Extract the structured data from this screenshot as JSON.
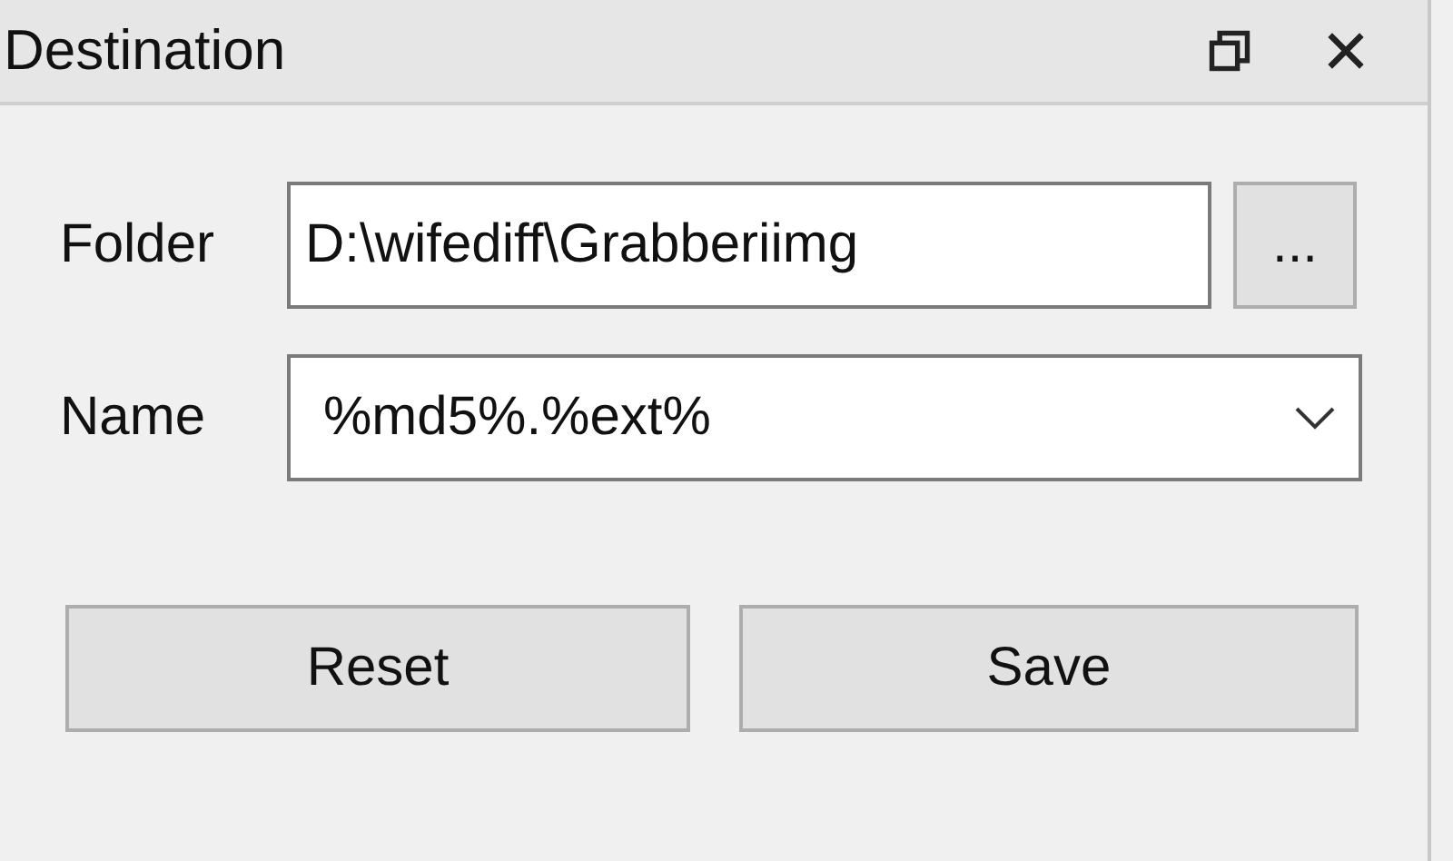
{
  "panel": {
    "title": "Destination"
  },
  "fields": [
    {
      "kind": "text",
      "label": "Folder",
      "value": "D:\\wifediff\\Grabberiimg",
      "button": "..."
    },
    {
      "kind": "combo",
      "label": "Name",
      "value": "%md5%.%ext%"
    }
  ],
  "buttons": [
    "Reset",
    "Save"
  ]
}
